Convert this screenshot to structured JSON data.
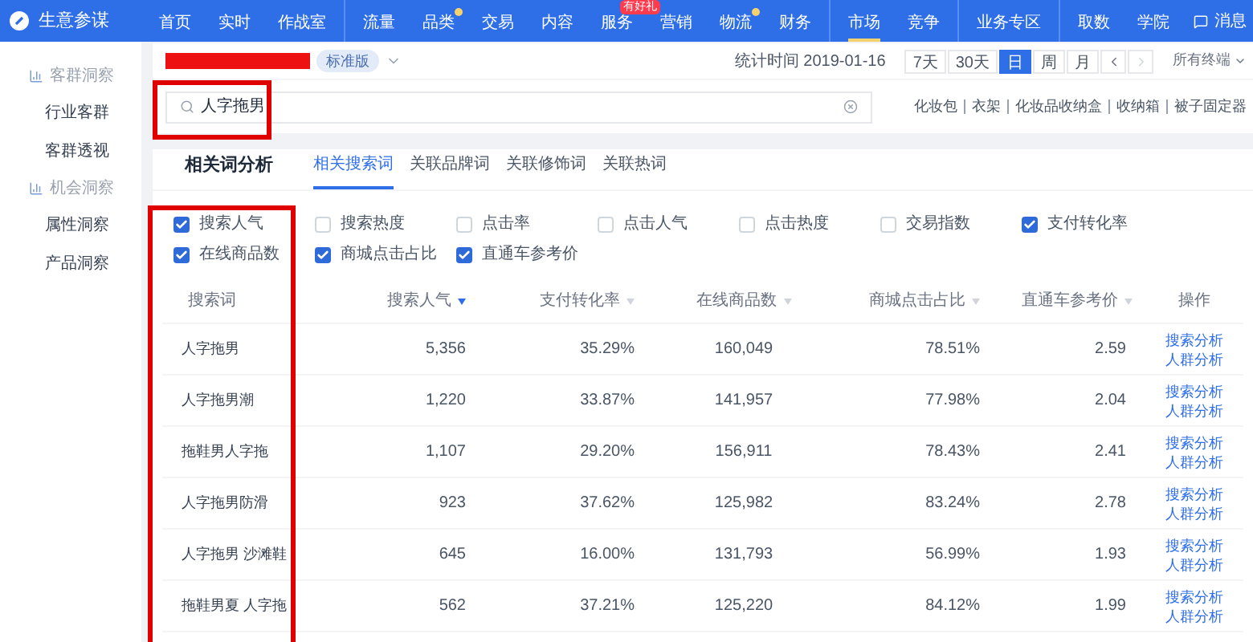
{
  "app": {
    "title": "生意参谋"
  },
  "nav": [
    [
      {
        "label": "首页",
        "selected": false
      },
      {
        "label": "实时",
        "selected": false
      },
      {
        "label": "作战室",
        "selected": false
      }
    ],
    [
      {
        "label": "流量",
        "selected": false
      },
      {
        "label": "品类",
        "selected": false,
        "dot": true
      },
      {
        "label": "交易",
        "selected": false
      },
      {
        "label": "内容",
        "selected": false
      },
      {
        "label": "服务",
        "selected": false,
        "badge": "有好礼"
      },
      {
        "label": "营销",
        "selected": false
      },
      {
        "label": "物流",
        "selected": false,
        "dot": true
      },
      {
        "label": "财务",
        "selected": false
      }
    ],
    [
      {
        "label": "市场",
        "selected": true
      },
      {
        "label": "竞争",
        "selected": false
      }
    ],
    [
      {
        "label": "业务专区",
        "selected": false
      }
    ],
    [
      {
        "label": "取数",
        "selected": false
      },
      {
        "label": "学院",
        "selected": false
      }
    ]
  ],
  "messages": {
    "label": "消息"
  },
  "sidebar": [
    {
      "heading": "客群洞察",
      "items": [
        {
          "label": "行业客群",
          "selected": false
        },
        {
          "label": "客群透视",
          "selected": false
        }
      ]
    },
    {
      "heading": "机会洞察",
      "items": [
        {
          "label": "属性洞察",
          "selected": false
        },
        {
          "label": "产品洞察",
          "selected": false
        }
      ]
    }
  ],
  "header": {
    "edition": "标准版",
    "stat_time": "统计时间 2019-01-16",
    "ranges": [
      {
        "label": "7天",
        "selected": false
      },
      {
        "label": "30天",
        "selected": false
      },
      {
        "label": "日",
        "selected": true
      },
      {
        "label": "周",
        "selected": false
      },
      {
        "label": "月",
        "selected": false
      }
    ],
    "terminal": "所有终端"
  },
  "search": {
    "value": "人字拖男",
    "suggestions": [
      "化妆包",
      "衣架",
      "化妆品收纳盒",
      "收纳箱",
      "被子固定器"
    ]
  },
  "panel": {
    "title": "相关词分析",
    "tabs": [
      {
        "label": "相关搜索词",
        "selected": true
      },
      {
        "label": "关联品牌词",
        "selected": false
      },
      {
        "label": "关联修饰词",
        "selected": false
      },
      {
        "label": "关联热词",
        "selected": false
      }
    ],
    "metrics": [
      {
        "label": "搜索人气",
        "checked": true
      },
      {
        "label": "搜索热度",
        "checked": false
      },
      {
        "label": "点击率",
        "checked": false
      },
      {
        "label": "点击人气",
        "checked": false
      },
      {
        "label": "点击热度",
        "checked": false
      },
      {
        "label": "交易指数",
        "checked": false
      },
      {
        "label": "支付转化率",
        "checked": true
      },
      {
        "label": "在线商品数",
        "checked": true
      },
      {
        "label": "商城点击占比",
        "checked": true
      },
      {
        "label": "直通车参考价",
        "checked": true
      }
    ],
    "columns": [
      {
        "label": "搜索词"
      },
      {
        "label": "搜索人气",
        "sorted": true
      },
      {
        "label": "支付转化率",
        "sorted": false
      },
      {
        "label": "在线商品数",
        "sorted": false
      },
      {
        "label": "商城点击占比",
        "sorted": false
      },
      {
        "label": "直通车参考价",
        "sorted": false
      },
      {
        "label": "操作"
      }
    ],
    "rows": [
      {
        "cells": [
          "人字拖男",
          "5,356",
          "35.29%",
          "160,049",
          "78.51%",
          "2.59"
        ],
        "actions": [
          "搜索分析",
          "人群分析"
        ]
      },
      {
        "cells": [
          "人字拖男潮",
          "1,220",
          "33.87%",
          "141,957",
          "77.98%",
          "2.04"
        ],
        "actions": [
          "搜索分析",
          "人群分析"
        ]
      },
      {
        "cells": [
          "拖鞋男人字拖",
          "1,107",
          "29.20%",
          "156,911",
          "78.43%",
          "2.41"
        ],
        "actions": [
          "搜索分析",
          "人群分析"
        ]
      },
      {
        "cells": [
          "人字拖男防滑",
          "923",
          "37.62%",
          "125,982",
          "83.24%",
          "2.78"
        ],
        "actions": [
          "搜索分析",
          "人群分析"
        ]
      },
      {
        "cells": [
          "人字拖男 沙滩鞋",
          "645",
          "16.00%",
          "131,793",
          "56.99%",
          "1.93"
        ],
        "actions": [
          "搜索分析",
          "人群分析"
        ]
      },
      {
        "cells": [
          "拖鞋男夏 人字拖",
          "562",
          "37.21%",
          "125,220",
          "84.12%",
          "1.99"
        ],
        "actions": [
          "搜索分析",
          "人群分析"
        ]
      }
    ]
  }
}
